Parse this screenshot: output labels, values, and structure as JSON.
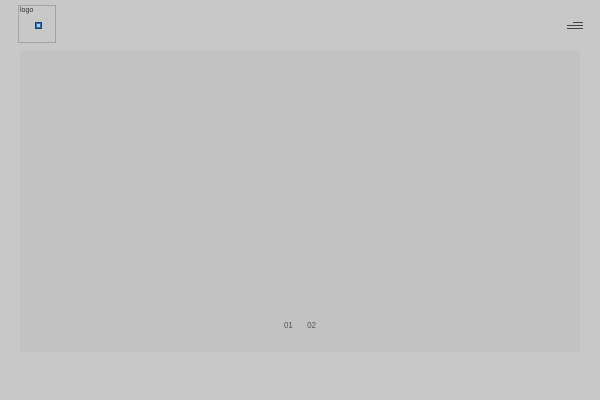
{
  "header": {
    "logo": {
      "alt_text": "logo",
      "icon": "broken-image-icon"
    },
    "menu": {
      "icon": "hamburger-menu-icon"
    }
  },
  "hero": {
    "pagination": [
      "01",
      "02"
    ]
  },
  "colors": {
    "page_background": "#c8c8c8",
    "hero_background": "#c2c2c2",
    "logo_icon": "#2f6fb3"
  }
}
